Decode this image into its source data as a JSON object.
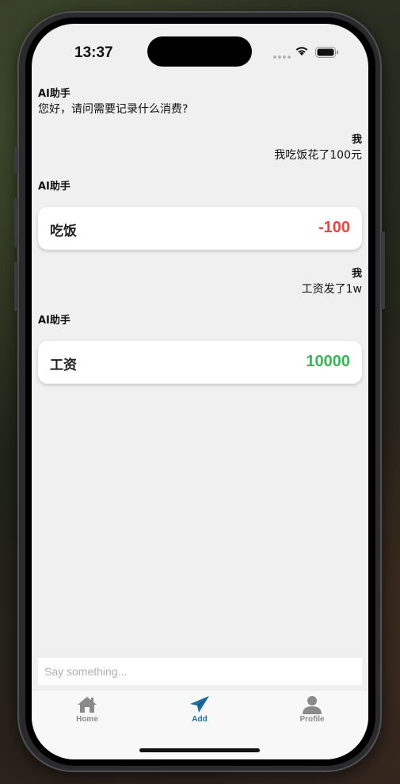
{
  "status_bar": {
    "time": "13:37"
  },
  "chat": {
    "messages": [
      {
        "sender": "AI助手",
        "text": "您好，请问需要记录什么消费?"
      },
      {
        "sender": "我",
        "text": "我吃饭花了100元"
      },
      {
        "sender": "AI助手",
        "card": {
          "label": "吃饭",
          "amount": "-100",
          "color": "#e04a42"
        }
      },
      {
        "sender": "我",
        "text": "工资发了1w"
      },
      {
        "sender": "AI助手",
        "card": {
          "label": "工资",
          "amount": "10000",
          "color": "#3fb15b"
        }
      }
    ]
  },
  "input": {
    "placeholder": "Say something..."
  },
  "tabs": [
    {
      "label": "Home",
      "icon": "home-icon",
      "active": false
    },
    {
      "label": "Add",
      "icon": "paper-plane-icon",
      "active": true
    },
    {
      "label": "Profile",
      "icon": "person-icon",
      "active": false
    }
  ],
  "colors": {
    "tab_active": "#1f6fa3",
    "tab_inactive": "#8a8a8a",
    "expense": "#e04a42",
    "income": "#3fb15b"
  }
}
